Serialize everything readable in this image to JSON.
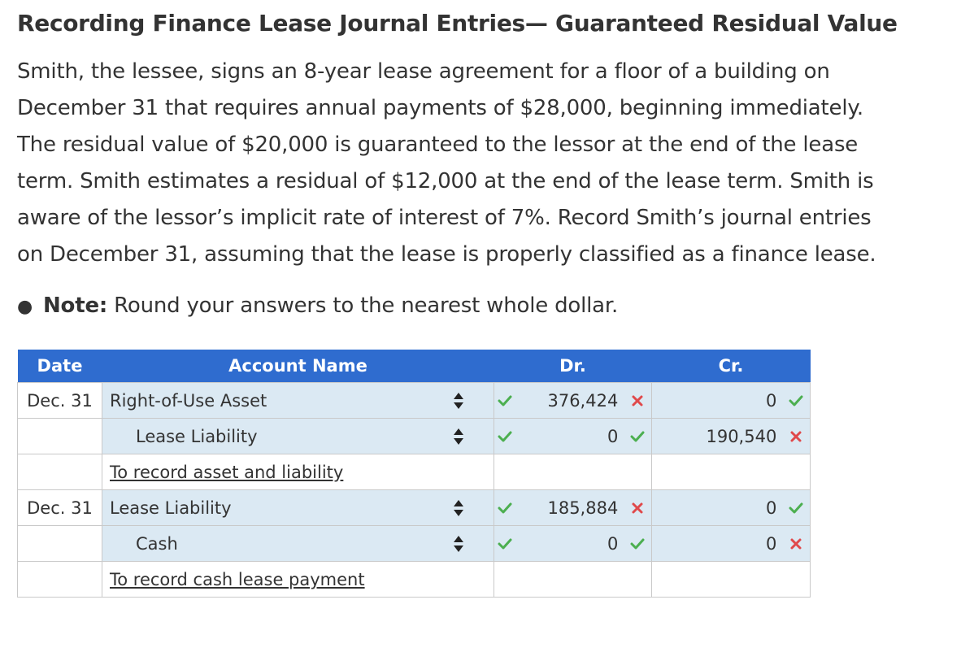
{
  "title": "Recording Finance Lease Journal Entries— Guaranteed Residual Value",
  "paragraph_lines": [
    "Smith, the lessee, signs an 8-year lease agreement for a floor of a building on",
    "December 31 that requires annual payments of $28,000, beginning immediately.",
    "The residual value of $20,000 is guaranteed to the lessor at the end of the lease",
    "term. Smith estimates a residual of $12,000 at the end of the lease term. Smith is",
    "aware of the lessor’s implicit rate of interest of 7%. Record Smith’s journal entries",
    "on December 31, assuming that the lease is properly classified as a finance lease."
  ],
  "note": {
    "bullet": "●",
    "label": "Note:",
    "text": " Round your answers to the nearest whole dollar."
  },
  "table": {
    "headers": {
      "date": "Date",
      "account": "Account Name",
      "dr": "Dr.",
      "cr": "Cr."
    },
    "rows": [
      {
        "date": "Dec. 31",
        "account": "Right-of-Use Asset",
        "dr": "376,424",
        "dr_status": "wrong",
        "cr": "0",
        "cr_status": "correct"
      },
      {
        "date": "",
        "account": "Lease Liability",
        "dr": "0",
        "dr_status": "correct",
        "cr": "190,540",
        "cr_status": "wrong"
      },
      {
        "date": "",
        "memo": "To record asset and liability"
      },
      {
        "date": "Dec. 31",
        "account": "Lease Liability",
        "dr": "185,884",
        "dr_status": "wrong",
        "cr": "0",
        "cr_status": "correct"
      },
      {
        "date": "",
        "account": "Cash",
        "dr": "0",
        "dr_status": "correct",
        "cr": "0",
        "cr_status": "wrong"
      },
      {
        "date": "",
        "memo": "To record cash lease payment"
      }
    ]
  },
  "colors": {
    "header_bg": "#2f6ccf",
    "input_bg": "#dbe9f3",
    "correct": "#4caf50",
    "wrong": "#e0494b"
  },
  "icons": {
    "select_arrows": "up-down-arrows-icon",
    "correct": "check-icon",
    "wrong": "x-icon"
  }
}
